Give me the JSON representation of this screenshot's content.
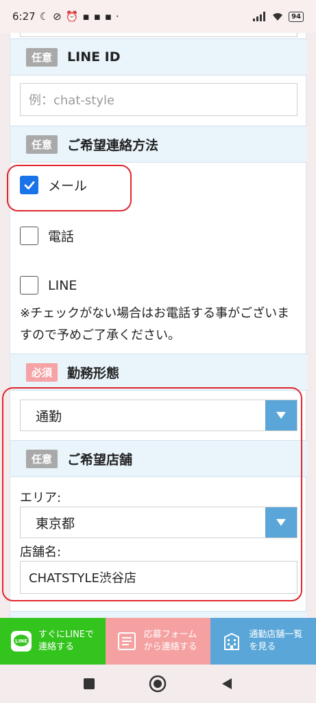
{
  "status": {
    "time": "6:27",
    "battery": "94"
  },
  "sections": {
    "line_id": {
      "badge": "任意",
      "title": "LINE ID",
      "placeholder": "例：chat-style"
    },
    "contact_method": {
      "badge": "任意",
      "title": "ご希望連絡方法",
      "options": [
        {
          "label": "メール",
          "checked": true
        },
        {
          "label": "電話",
          "checked": false
        },
        {
          "label": "LINE",
          "checked": false
        }
      ],
      "note": "※チェックがない場合はお電話する事がございますので予めご了承ください。"
    },
    "work_style": {
      "badge": "必須",
      "title": "勤務形態",
      "selected": "通勤"
    },
    "store": {
      "badge": "任意",
      "title": "ご希望店舗",
      "area_label": "エリア:",
      "area_selected": "東京都",
      "store_label": "店舗名:",
      "store_value": "CHATSTYLE渋谷店"
    }
  },
  "bottom_bar": {
    "line_btn": {
      "line1": "すぐにLINEで",
      "line2": "連絡する",
      "icon_text": "LINE"
    },
    "form_btn": {
      "line1": "応募フォーム",
      "line2": "から連絡する"
    },
    "store_btn": {
      "line1": "通勤店舗一覧",
      "line2": "を見る"
    }
  },
  "colors": {
    "optional_badge": "#a9a9a9",
    "required_badge": "#f5a3a6",
    "section_header_bg": "#e9f4fb",
    "checkbox_checked": "#1a73e8",
    "select_arrow": "#5aa6d8",
    "highlight_outline": "#e0252a",
    "line_green": "#33c41d",
    "form_pink": "#f5a1a1",
    "store_blue": "#5aa6d8"
  }
}
